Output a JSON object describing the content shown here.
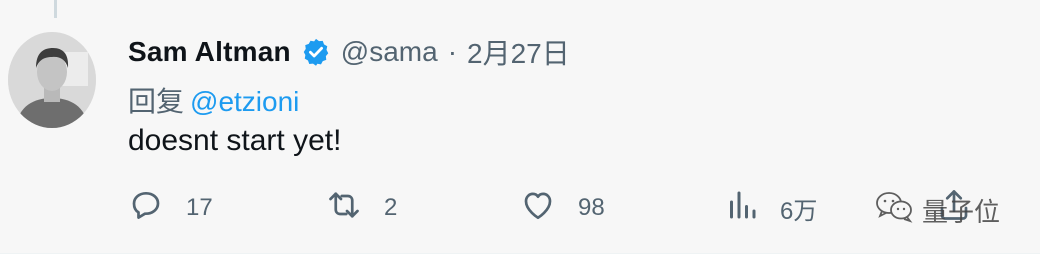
{
  "author": {
    "name": "Sam Altman",
    "handle": "@sama",
    "separator": "·",
    "date": "2月27日",
    "verified": true
  },
  "reply": {
    "prefix": "回复",
    "mention": "@etzioni"
  },
  "tweet": {
    "text": "doesnt start yet!"
  },
  "actions": {
    "reply_count": "17",
    "retweet_count": "2",
    "like_count": "98",
    "views_count": "6万"
  },
  "watermark": {
    "text": "量子位"
  },
  "colors": {
    "background": "#f7f7f7",
    "link": "#1d9bf0",
    "muted": "#536471",
    "text": "#0f1419"
  },
  "icons": [
    "verified-badge-icon",
    "reply-icon",
    "retweet-icon",
    "like-icon",
    "views-icon",
    "share-icon",
    "wechat-icon"
  ]
}
